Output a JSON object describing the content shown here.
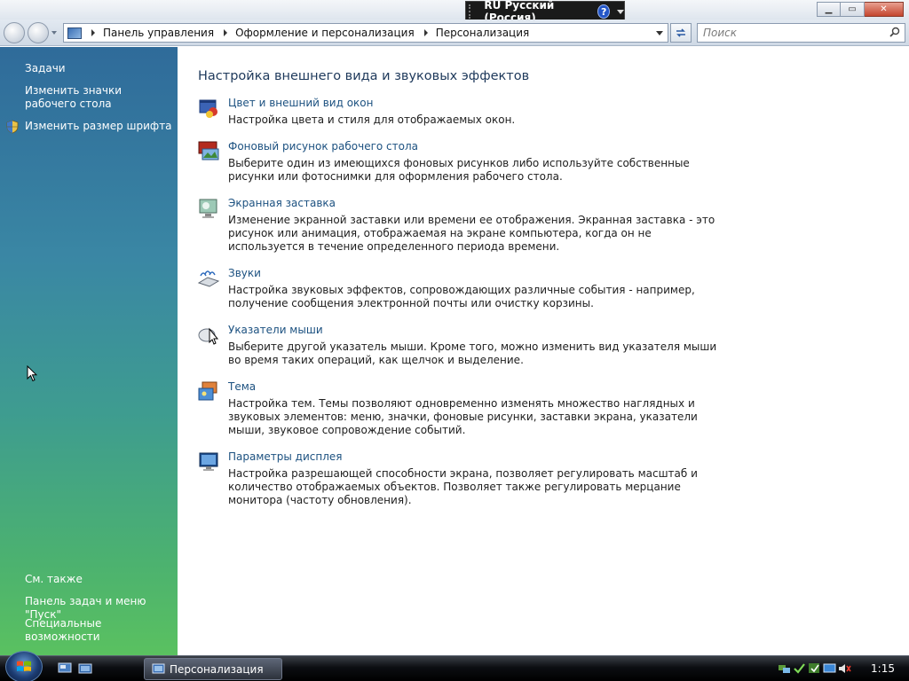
{
  "language_bar": {
    "text": "RU Русский (Россия)",
    "help": "?"
  },
  "address_bar": {
    "crumbs": [
      "Панель управления",
      "Оформление и персонализация",
      "Персонализация"
    ]
  },
  "search": {
    "placeholder": "Поиск"
  },
  "left_pane": {
    "tasks_heading": "Задачи",
    "tasks": [
      {
        "label": "Изменить значки рабочего стола"
      },
      {
        "label": "Изменить размер шрифта"
      }
    ],
    "see_also_heading": "См. также",
    "see_also": [
      {
        "label": "Панель задач и меню \"Пуск\""
      },
      {
        "label": "Специальные возможности"
      }
    ]
  },
  "main": {
    "title": "Настройка внешнего вида и звуковых эффектов",
    "items": [
      {
        "link": "Цвет и внешний вид окон",
        "desc": "Настройка цвета и стиля для отображаемых окон.",
        "icon": "window-color-icon"
      },
      {
        "link": "Фоновый рисунок рабочего стола",
        "desc": "Выберите один из имеющихся фоновых рисунков либо используйте собственные рисунки или фотоснимки для оформления рабочего стола.",
        "icon": "desktop-background-icon"
      },
      {
        "link": "Экранная заставка",
        "desc": "Изменение экранной заставки или времени ее отображения. Экранная заставка - это рисунок или анимация, отображаемая на экране компьютера, когда он не используется в течение определенного периода времени.",
        "icon": "screensaver-icon"
      },
      {
        "link": "Звуки",
        "desc": "Настройка звуковых эффектов, сопровождающих различные события - например, получение сообщения электронной почты или очистку корзины.",
        "icon": "sounds-icon"
      },
      {
        "link": "Указатели мыши",
        "desc": "Выберите другой указатель мыши. Кроме того, можно изменить вид указателя мыши во время таких операций, как щелчок и выделение.",
        "icon": "mouse-pointer-icon"
      },
      {
        "link": "Тема",
        "desc": "Настройка тем. Темы позволяют одновременно изменять множество наглядных и звуковых элементов: меню, значки, фоновые рисунки, заставки экрана, указатели мыши, звуковое сопровождение событий.",
        "icon": "theme-icon"
      },
      {
        "link": "Параметры дисплея",
        "desc": "Настройка разрешающей способности экрана, позволяет регулировать масштаб и количество отображаемых объектов. Позволяет также регулировать мерцание монитора (частоту обновления).",
        "icon": "display-settings-icon"
      }
    ]
  },
  "taskbar": {
    "active_window": "Персонализация",
    "clock": "1:15"
  }
}
